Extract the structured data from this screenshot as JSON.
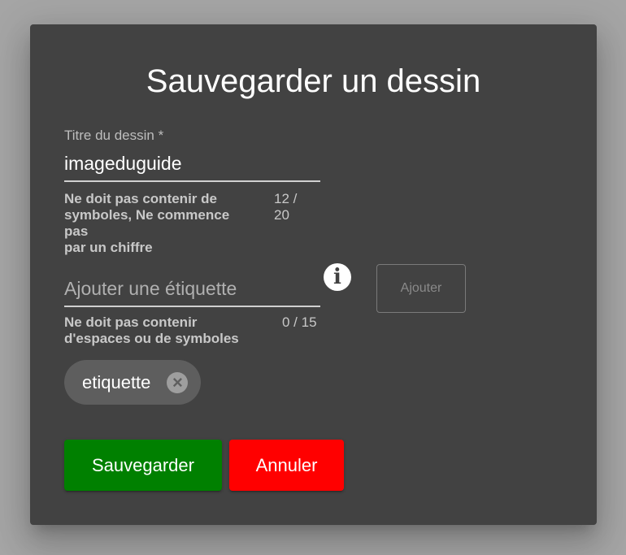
{
  "dialog": {
    "title": "Sauvegarder un dessin"
  },
  "title_field": {
    "label": "Titre du dessin *",
    "value": "imageduguide",
    "hint_lines": [
      "Ne doit pas contenir de",
      "symboles, Ne commence",
      "pas",
      "par un chiffre"
    ],
    "counter_line1": "12 /",
    "counter_line2": "20"
  },
  "tag_field": {
    "placeholder": "Ajouter une étiquette",
    "value": "",
    "hint_lines": [
      "Ne doit pas contenir",
      "d'espaces ou de symboles"
    ],
    "counter": "0 / 15",
    "info_icon": "info-icon",
    "add_label": "Ajouter"
  },
  "tags": [
    {
      "label": "etiquette",
      "remove_icon": "cancel-icon"
    }
  ],
  "actions": {
    "save_label": "Sauvegarder",
    "cancel_label": "Annuler"
  },
  "colors": {
    "dialog_bg": "#424242",
    "backdrop": "#a5a5a5",
    "save": "#008000",
    "cancel": "#ff0000",
    "chip_bg": "#5e5e5e"
  }
}
